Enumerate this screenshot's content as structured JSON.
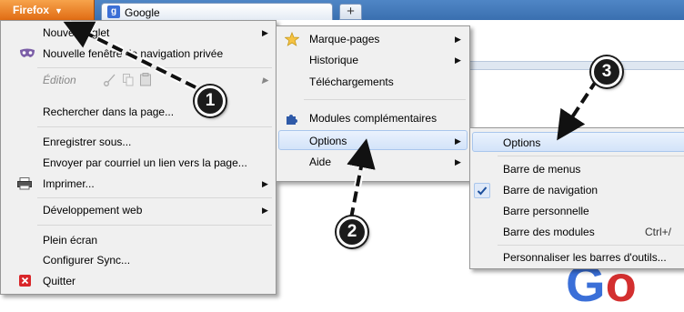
{
  "titlebar": {
    "firefox_label": "Firefox",
    "tab_label": "Google",
    "tab_icon": "google-g-icon",
    "new_tab": "+"
  },
  "menu_main": {
    "items": [
      {
        "label": "Nouvel onglet",
        "submenu": true
      },
      {
        "label": "Nouvelle fenêtre de navigation privée",
        "icon": "private-browsing-mask-icon"
      },
      {
        "label": "Édition",
        "disabled": true,
        "submenu": true,
        "icons": [
          "cut-icon",
          "copy-icon",
          "paste-icon"
        ]
      },
      {
        "label": "Rechercher dans la page..."
      },
      {
        "label": "Enregistrer sous..."
      },
      {
        "label": "Envoyer par courriel un lien vers la page..."
      },
      {
        "label": "Imprimer...",
        "submenu": true,
        "icon": "printer-icon"
      },
      {
        "label": "Développement web",
        "submenu": true
      },
      {
        "label": "Plein écran"
      },
      {
        "label": "Configurer Sync..."
      },
      {
        "label": "Quitter",
        "icon": "quit-red-x-icon"
      }
    ]
  },
  "menu_right": {
    "items": [
      {
        "label": "Marque-pages",
        "submenu": true,
        "icon": "star-icon"
      },
      {
        "label": "Historique",
        "submenu": true
      },
      {
        "label": "Téléchargements"
      },
      {
        "label": "Modules complémentaires",
        "icon": "puzzle-piece-icon"
      },
      {
        "label": "Options",
        "submenu": true,
        "highlighted": true
      },
      {
        "label": "Aide",
        "submenu": true
      }
    ]
  },
  "menu_options": {
    "items": [
      {
        "label": "Options",
        "highlighted": true
      },
      {
        "label": "Barre de menus"
      },
      {
        "label": "Barre de navigation",
        "checked": true
      },
      {
        "label": "Barre personnelle"
      },
      {
        "label": "Barre des modules",
        "shortcut": "Ctrl+/"
      },
      {
        "label": "Personnaliser les barres d'outils..."
      }
    ]
  },
  "annotations": {
    "steps": [
      "1",
      "2",
      "3"
    ]
  },
  "colors": {
    "firefox_button": "#e06c14",
    "titlebar": "#3a6fb0",
    "menu_bg": "#f0f0f0",
    "highlight": "#d3e3f9"
  }
}
